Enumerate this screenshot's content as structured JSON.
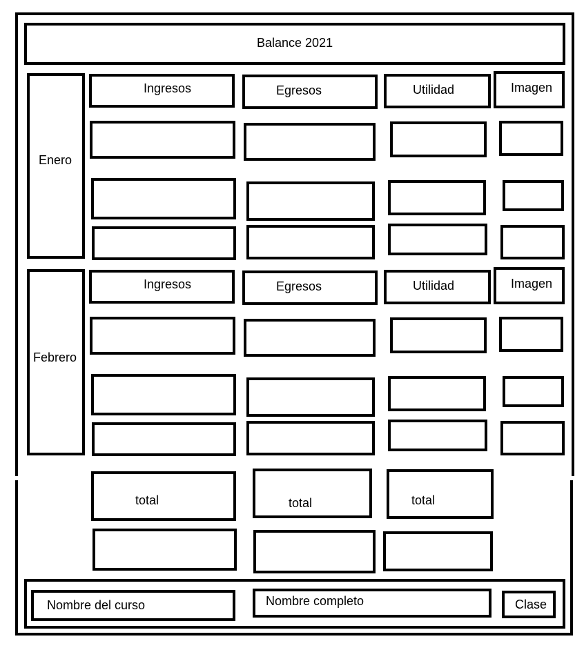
{
  "title": "Balance 2021",
  "months": [
    {
      "name": "Enero",
      "headers": {
        "ingresos": "Ingresos",
        "egresos": "Egresos",
        "utilidad": "Utilidad",
        "imagen": "Imagen"
      }
    },
    {
      "name": "Febrero",
      "headers": {
        "ingresos": "Ingresos",
        "egresos": "Egresos",
        "utilidad": "Utilidad",
        "imagen": "Imagen"
      }
    }
  ],
  "totals": {
    "ingresos": "total",
    "egresos": "total",
    "utilidad": "total"
  },
  "footer": {
    "course": "Nombre del curso",
    "fullname": "Nombre completo",
    "class": "Clase"
  }
}
